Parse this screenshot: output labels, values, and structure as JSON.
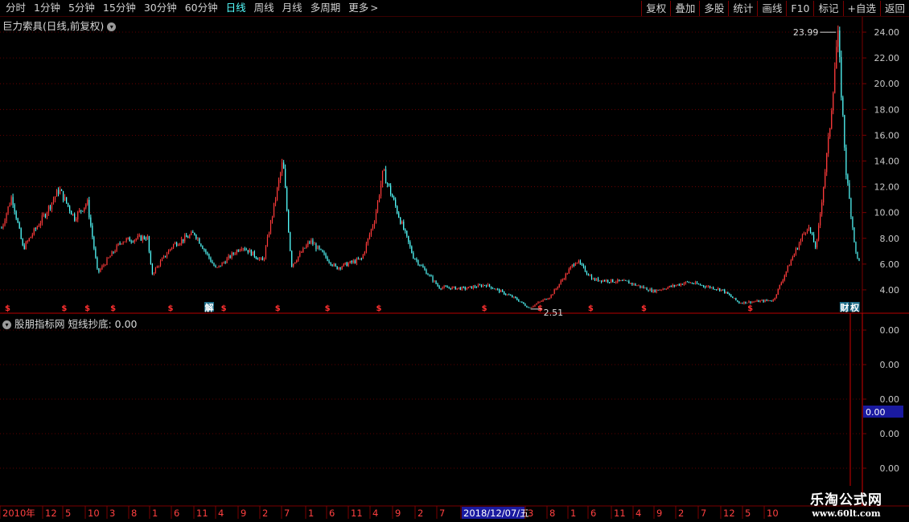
{
  "toolbar": {
    "periods": [
      {
        "label": "分时",
        "active": false
      },
      {
        "label": "1分钟",
        "active": false
      },
      {
        "label": "5分钟",
        "active": false
      },
      {
        "label": "15分钟",
        "active": false
      },
      {
        "label": "30分钟",
        "active": false
      },
      {
        "label": "60分钟",
        "active": false
      },
      {
        "label": "日线",
        "active": true
      },
      {
        "label": "周线",
        "active": false
      },
      {
        "label": "月线",
        "active": false
      },
      {
        "label": "多周期",
        "active": false
      },
      {
        "label": "更多",
        "active": false
      }
    ],
    "actions": [
      "复权",
      "叠加",
      "多股",
      "统计",
      "画线",
      "F10",
      "标记",
      "+自选",
      "返回"
    ]
  },
  "main_panel": {
    "title": "巨力索具(日线,前复权)"
  },
  "sub_panel": {
    "title": "股朋指标网 短线抄底:",
    "value": "0.00"
  },
  "watermark": {
    "title": "乐淘公式网",
    "url": "www.60lt.com"
  },
  "colors": {
    "up": "#ff3b3b",
    "down": "#54ffff",
    "grid": "#7a0000",
    "axis_text": "#c8c8c8",
    "date_highlight_bg": "#1a1aa0"
  },
  "chart_data": [
    {
      "type": "candlestick",
      "title": "巨力索具(日线,前复权)",
      "ylim": [
        2.5,
        24.5
      ],
      "y_ticks": [
        4,
        6,
        8,
        10,
        12,
        14,
        16,
        18,
        20,
        22,
        24
      ],
      "y_tick_labels": [
        "4.00",
        "6.00",
        "8.00",
        "10.00",
        "12.00",
        "14.00",
        "16.00",
        "18.00",
        "20.00",
        "22.00",
        "24.00"
      ],
      "annotations": [
        {
          "label": "23.99",
          "value": 23.99
        },
        {
          "label": "2.51",
          "value": 2.51
        }
      ],
      "event_markers": [
        {
          "label": "$",
          "position": 0.007
        },
        {
          "label": "$",
          "position": 0.073
        },
        {
          "label": "$",
          "position": 0.1
        },
        {
          "label": "$",
          "position": 0.13
        },
        {
          "label": "$",
          "position": 0.197
        },
        {
          "label": "解",
          "position": 0.242
        },
        {
          "label": "$",
          "position": 0.259
        },
        {
          "label": "$",
          "position": 0.322
        },
        {
          "label": "$",
          "position": 0.38
        },
        {
          "label": "$",
          "position": 0.44
        },
        {
          "label": "$",
          "position": 0.563
        },
        {
          "label": "$",
          "position": 0.628
        },
        {
          "label": "$",
          "position": 0.687
        },
        {
          "label": "$",
          "position": 0.749
        },
        {
          "label": "$",
          "position": 0.873
        },
        {
          "label": "财",
          "position": 0.983
        },
        {
          "label": "权",
          "position": 0.995
        }
      ],
      "series_close": [
        {
          "t": 0.0,
          "v": 8.8
        },
        {
          "t": 0.012,
          "v": 11.3
        },
        {
          "t": 0.025,
          "v": 7.2
        },
        {
          "t": 0.05,
          "v": 9.8
        },
        {
          "t": 0.067,
          "v": 11.8
        },
        {
          "t": 0.085,
          "v": 9.6
        },
        {
          "t": 0.1,
          "v": 10.8
        },
        {
          "t": 0.112,
          "v": 5.3
        },
        {
          "t": 0.14,
          "v": 7.8
        },
        {
          "t": 0.17,
          "v": 8.1
        },
        {
          "t": 0.175,
          "v": 5.2
        },
        {
          "t": 0.2,
          "v": 7.5
        },
        {
          "t": 0.225,
          "v": 8.4
        },
        {
          "t": 0.25,
          "v": 5.6
        },
        {
          "t": 0.28,
          "v": 7.4
        },
        {
          "t": 0.305,
          "v": 6.2
        },
        {
          "t": 0.328,
          "v": 14.0
        },
        {
          "t": 0.338,
          "v": 5.9
        },
        {
          "t": 0.36,
          "v": 7.8
        },
        {
          "t": 0.39,
          "v": 5.7
        },
        {
          "t": 0.42,
          "v": 6.4
        },
        {
          "t": 0.435,
          "v": 9.5
        },
        {
          "t": 0.445,
          "v": 13.2
        },
        {
          "t": 0.465,
          "v": 9.4
        },
        {
          "t": 0.48,
          "v": 6.6
        },
        {
          "t": 0.51,
          "v": 4.2
        },
        {
          "t": 0.54,
          "v": 4.1
        },
        {
          "t": 0.565,
          "v": 4.4
        },
        {
          "t": 0.6,
          "v": 3.3
        },
        {
          "t": 0.615,
          "v": 2.6
        },
        {
          "t": 0.64,
          "v": 3.5
        },
        {
          "t": 0.67,
          "v": 6.3
        },
        {
          "t": 0.69,
          "v": 4.8
        },
        {
          "t": 0.73,
          "v": 4.6
        },
        {
          "t": 0.76,
          "v": 3.9
        },
        {
          "t": 0.8,
          "v": 4.6
        },
        {
          "t": 0.84,
          "v": 4.0
        },
        {
          "t": 0.86,
          "v": 3.0
        },
        {
          "t": 0.9,
          "v": 3.2
        },
        {
          "t": 0.92,
          "v": 6.2
        },
        {
          "t": 0.94,
          "v": 9.0
        },
        {
          "t": 0.95,
          "v": 7.2
        },
        {
          "t": 0.965,
          "v": 16.0
        },
        {
          "t": 0.975,
          "v": 23.99
        },
        {
          "t": 0.985,
          "v": 13.0
        },
        {
          "t": 0.997,
          "v": 6.4
        }
      ]
    },
    {
      "type": "line",
      "title": "股朋指标网 短线抄底",
      "ylim": [
        -0.01,
        0.01
      ],
      "y_tick_labels": [
        "0.00",
        "0.00",
        "0.00",
        "0.00",
        "0.00"
      ],
      "current_value_label": "0.00",
      "values": [
        0
      ]
    }
  ],
  "x_axis": {
    "labels": [
      "2010年",
      "12",
      "5",
      "10",
      "3",
      "8",
      "1",
      "6",
      "11",
      "4",
      "9",
      "2",
      "7",
      "1",
      "6",
      "11",
      "4",
      "9",
      "2",
      "7",
      "2018/12/07/五",
      "3",
      "8",
      "1",
      "6",
      "11",
      "4",
      "9",
      "2",
      "7",
      "12",
      "5",
      "10"
    ],
    "highlight": "2018/12/07/五"
  }
}
